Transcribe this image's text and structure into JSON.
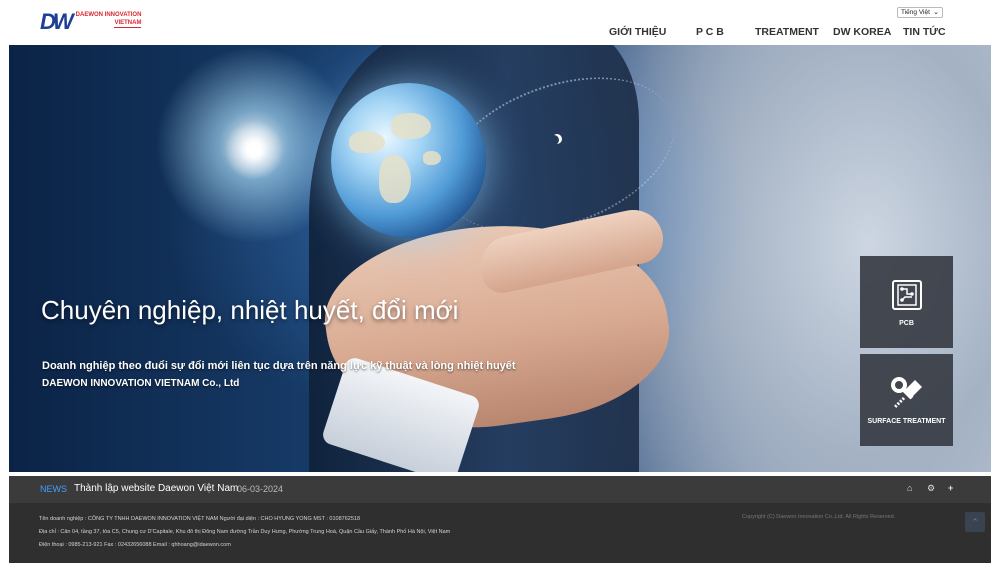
{
  "header": {
    "logo_mark": "DW",
    "logo_line1": "DAEWON INNOVATION",
    "logo_line2": "VIETNAM",
    "language": "Tiếng Việt",
    "nav": [
      "GIỚI THIỆU",
      "P C B",
      "TREATMENT",
      "DW KOREA",
      "TIN TỨC"
    ]
  },
  "hero": {
    "title": "Chuyên nghiệp, nhiệt huyết, đổi mới",
    "subtitle_line1": "Doanh nghiệp theo đuổi sự đổi mới liên tục dựa trên năng lực kỹ thuật và lòng nhiệt huyết",
    "subtitle_line2": "DAEWON INNOVATION VIETNAM Co., Ltd",
    "tiles": [
      {
        "label": "PCB",
        "icon": "circuit-board-icon"
      },
      {
        "label": "SURFACE TREATMENT",
        "icon": "bolt-wrench-icon"
      }
    ]
  },
  "news": {
    "tag": "NEWS",
    "title": "Thành lập website Daewon Việt Nam",
    "date": "06-03-2024",
    "icons": [
      "home-icon",
      "gear-icon",
      "plus-icon"
    ]
  },
  "footer": {
    "line1": "Tên doanh nghiệp : CÔNG TY TNHH DAEWON INNOVATION VIỆT NAM     Người đại diện : CHO HYUNG YONG     MST : 0108762518",
    "line2": "Địa chỉ : Căn 04, tầng 37, tòa C5, Chung cư D'Capitale, Khu đô thị Đông Nam đường Trần Duy Hưng, Phường Trung Hoà, Quận Cầu Giấy, Thành Phố Hà Nội, Việt Nam",
    "line3": "Điện thoại : 0985-213-921     Fax : 02432656088     Email : qhhoang@idaewon.com",
    "copyright": "Copyright (C) Daewon Innovation Co.,Ltd. All Rights Reserved."
  },
  "colors": {
    "brand_blue": "#1d3f94",
    "brand_red": "#d8262e",
    "news_accent": "#3ea1ff",
    "footer_bg": "#2f2f2f"
  }
}
